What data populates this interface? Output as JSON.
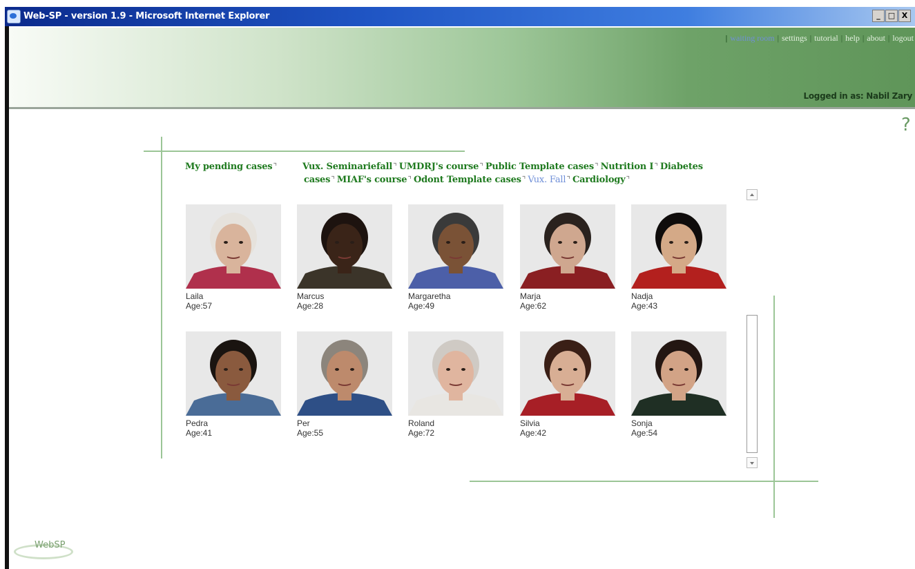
{
  "window": {
    "title": "Web-SP - version 1.9 - Microsoft Internet Explorer",
    "buttons": [
      "_",
      "□",
      "X"
    ]
  },
  "topnav": {
    "items": [
      {
        "label": "waiting room",
        "current": true
      },
      {
        "label": "settings"
      },
      {
        "label": "tutorial"
      },
      {
        "label": "help"
      },
      {
        "label": "about"
      },
      {
        "label": "logout"
      }
    ]
  },
  "user": {
    "logged_in": "Logged in as: Nabil Zary"
  },
  "help_icon": "?",
  "tabs": {
    "first": "My pending cases",
    "row1": [
      "Vux. Seminariefall",
      "UMDRJ's course",
      "Public Template cases",
      "Nutrition I",
      "Diabetes"
    ],
    "row2": [
      "cases",
      "MIAF's course",
      "Odont Template cases",
      "Vux. Fall",
      "Cardiology"
    ],
    "current": "Vux. Fall"
  },
  "patients": [
    {
      "name": "Laila",
      "age": "Age:57",
      "hair": "#e6e2dc",
      "skin": "#d9b49c",
      "shirt": "#b0304c"
    },
    {
      "name": "Marcus",
      "age": "Age:28",
      "hair": "#1d130f",
      "skin": "#3a2418",
      "shirt": "#3b3429"
    },
    {
      "name": "Margaretha",
      "age": "Age:49",
      "hair": "#3a3a3a",
      "skin": "#7a5236",
      "shirt": "#4c5fa8"
    },
    {
      "name": "Marja",
      "age": "Age:62",
      "hair": "#2a221e",
      "skin": "#cfa78f",
      "shirt": "#8a1f22"
    },
    {
      "name": "Nadja",
      "age": "Age:43",
      "hair": "#0f0c0b",
      "skin": "#d4a987",
      "shirt": "#b3201e"
    },
    {
      "name": "Pedra",
      "age": "Age:41",
      "hair": "#1a1410",
      "skin": "#8a5a3e",
      "shirt": "#4a6c97"
    },
    {
      "name": "Per",
      "age": "Age:55",
      "hair": "#8c857c",
      "skin": "#bd8a6c",
      "shirt": "#2e4f86"
    },
    {
      "name": "Roland",
      "age": "Age:72",
      "hair": "#cfcac4",
      "skin": "#e0b59f",
      "shirt": "#e8e6e2"
    },
    {
      "name": "Silvia",
      "age": "Age:42",
      "hair": "#3a1f16",
      "skin": "#d8ae94",
      "shirt": "#a71f26"
    },
    {
      "name": "Sonja",
      "age": "Age:54",
      "hair": "#231612",
      "skin": "#d2a386",
      "shirt": "#1f2f24"
    }
  ],
  "logo": {
    "text": "WebSP"
  }
}
